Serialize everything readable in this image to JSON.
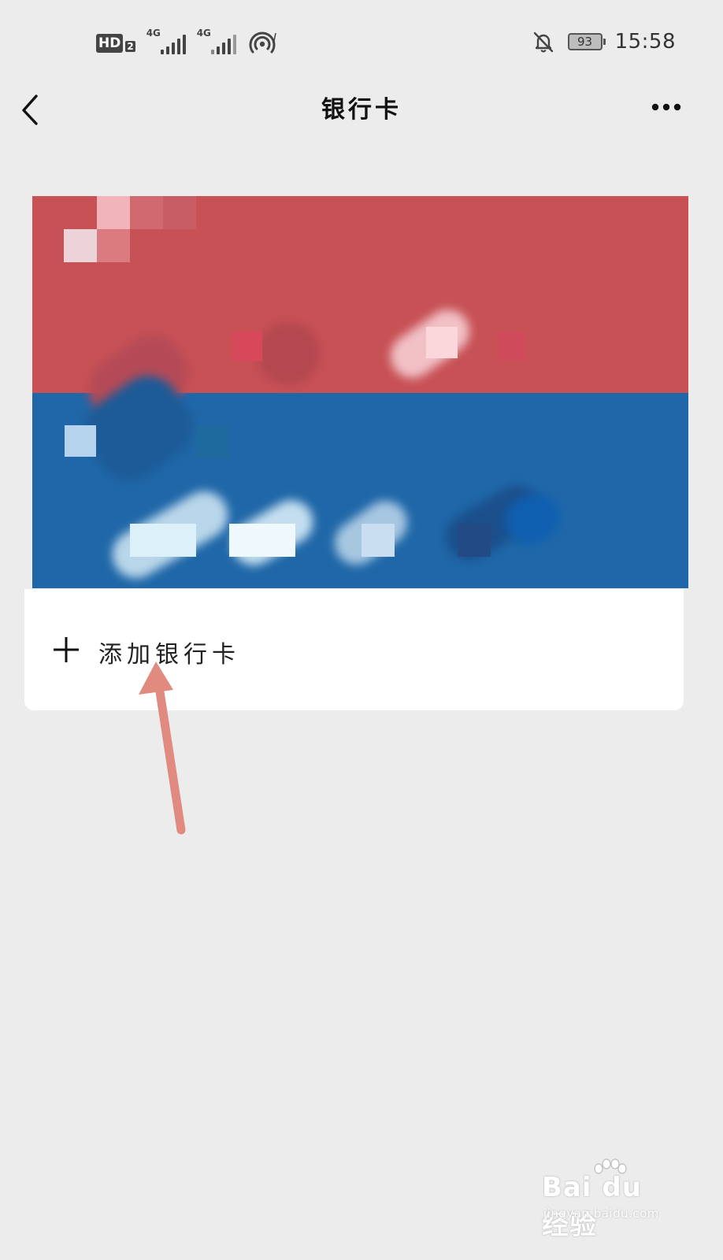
{
  "status_bar": {
    "hd_label": "HD",
    "sim_index": "2",
    "network_1": "4G",
    "network_2": "4G",
    "battery_level": "93",
    "time": "15:58",
    "icons": [
      "hd-icon",
      "signal-icon",
      "hotspot-icon",
      "bell-off-icon",
      "battery-icon"
    ]
  },
  "nav": {
    "title": "银行卡",
    "back_icon": "chevron-left-icon",
    "more_icon": "more-dots-icon"
  },
  "card": {
    "top_color": "#c75155",
    "bottom_color": "#1f67a8",
    "obscured": true
  },
  "add_card": {
    "icon": "plus-icon",
    "label": "添加银行卡"
  },
  "annotation": {
    "icon": "arrow-annotation",
    "color": "#e08a80"
  },
  "watermark": {
    "brand": "Bai du 经验",
    "url": "jingyan.baidu.com"
  }
}
